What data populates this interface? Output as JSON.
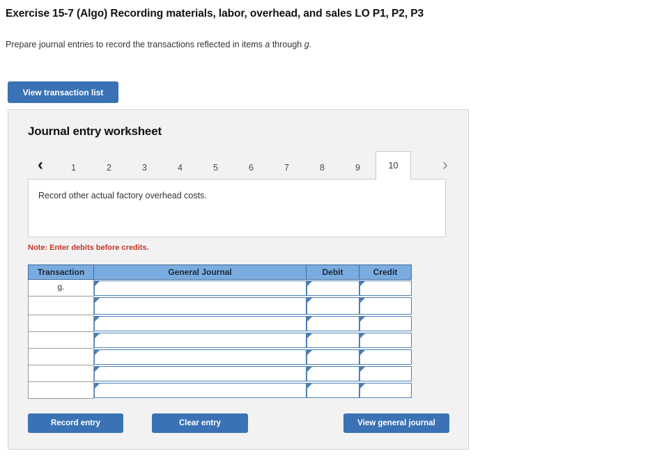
{
  "exercise": {
    "title": "Exercise 15-7 (Algo) Recording materials, labor, overhead, and sales LO P1, P2, P3",
    "instructions_prefix": "Prepare journal entries to record the transactions reflected in items ",
    "instructions_italic_1": "a",
    "instructions_mid": " through ",
    "instructions_italic_2": "g",
    "instructions_suffix": "."
  },
  "toolbar": {
    "view_transaction_list_label": "View transaction list"
  },
  "worksheet": {
    "title": "Journal entry worksheet",
    "prev_arrow": "‹",
    "next_arrow": "›",
    "tabs": [
      {
        "label": "1",
        "active": false
      },
      {
        "label": "2",
        "active": false
      },
      {
        "label": "3",
        "active": false
      },
      {
        "label": "4",
        "active": false
      },
      {
        "label": "5",
        "active": false
      },
      {
        "label": "6",
        "active": false
      },
      {
        "label": "7",
        "active": false
      },
      {
        "label": "8",
        "active": false
      },
      {
        "label": "9",
        "active": false
      },
      {
        "label": "10",
        "active": true
      }
    ],
    "instruction_text": "Record other actual factory overhead costs.",
    "note": "Note: Enter debits before credits."
  },
  "table": {
    "headers": [
      "Transaction",
      "General Journal",
      "Debit",
      "Credit"
    ],
    "rows": [
      {
        "transaction": "g.",
        "general_journal": "",
        "debit": "",
        "credit": "",
        "tall": false
      },
      {
        "transaction": "",
        "general_journal": "",
        "debit": "",
        "credit": "",
        "tall": true
      },
      {
        "transaction": "",
        "general_journal": "",
        "debit": "",
        "credit": "",
        "tall": false
      },
      {
        "transaction": "",
        "general_journal": "",
        "debit": "",
        "credit": "",
        "tall": false
      },
      {
        "transaction": "",
        "general_journal": "",
        "debit": "",
        "credit": "",
        "tall": false
      },
      {
        "transaction": "",
        "general_journal": "",
        "debit": "",
        "credit": "",
        "tall": false
      },
      {
        "transaction": "",
        "general_journal": "",
        "debit": "",
        "credit": "",
        "tall": false
      }
    ]
  },
  "actions": {
    "record_entry_label": "Record entry",
    "clear_entry_label": "Clear entry",
    "view_general_journal_label": "View general journal"
  },
  "colors": {
    "button_blue": "#3A72B5",
    "table_header_blue": "#7BACE0",
    "input_border_blue": "#4A7FB5",
    "panel_bg": "#F2F2F2",
    "note_red": "#C0392B"
  }
}
